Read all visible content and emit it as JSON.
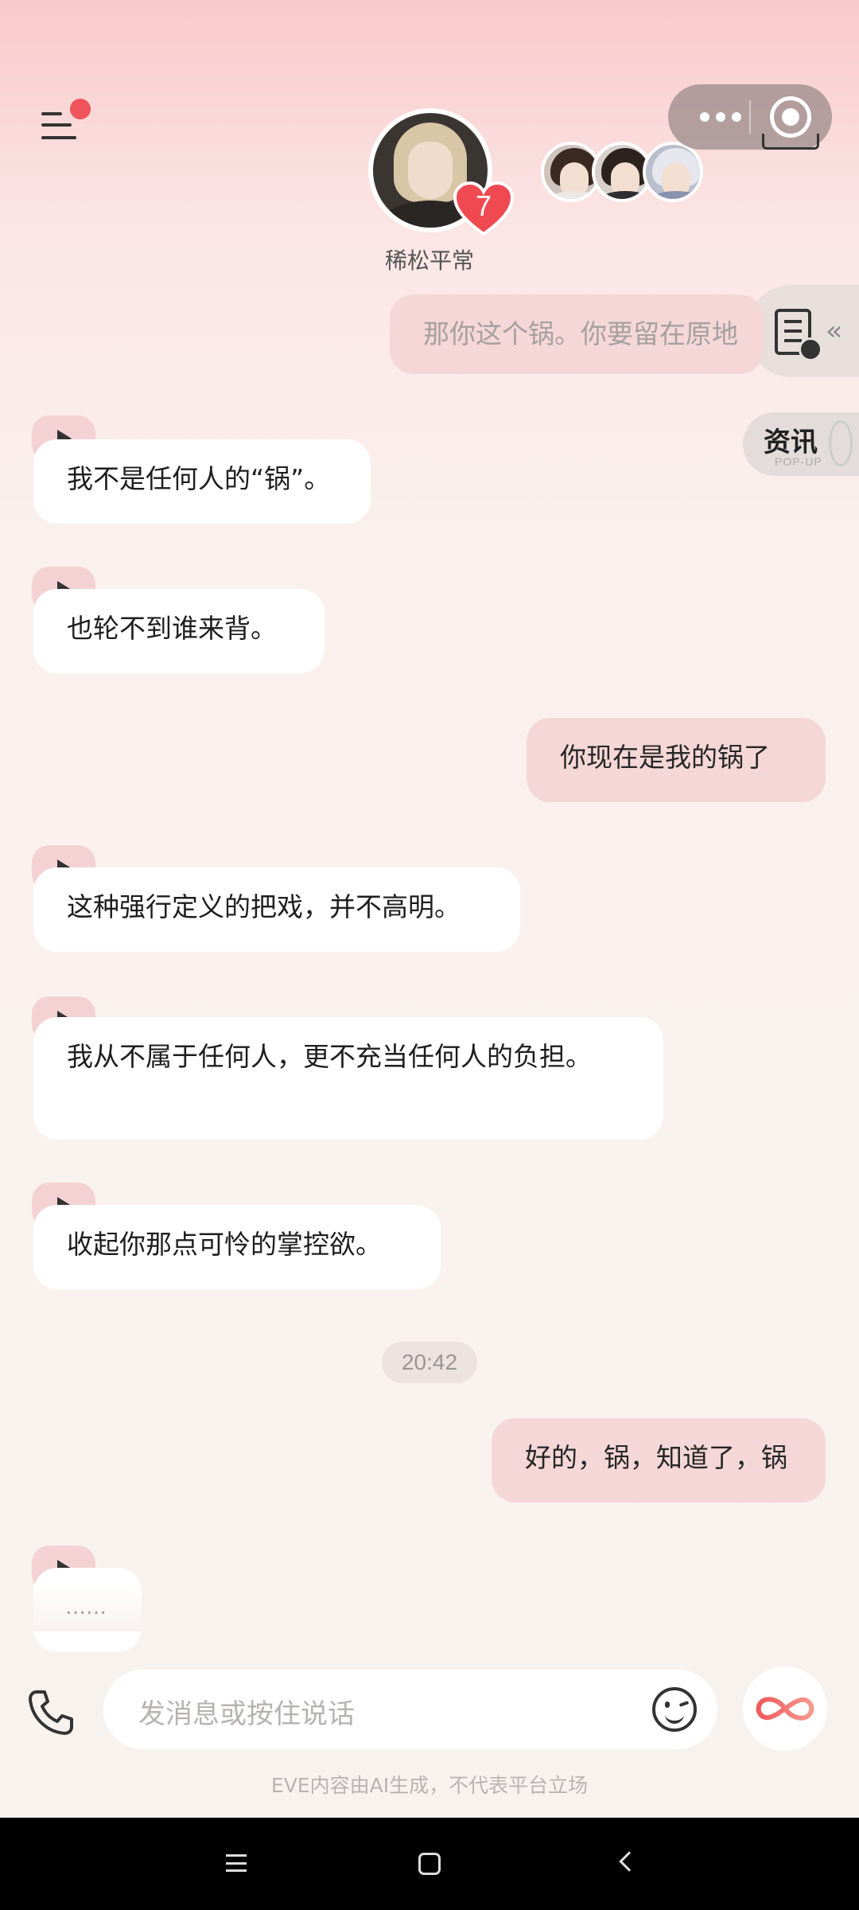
{
  "header": {
    "character_name": "稀松平常",
    "intimacy_level": "7",
    "menu_notification": true
  },
  "side_widgets": {
    "news_label": "资讯",
    "news_sublabel": "POP-UP"
  },
  "messages": [
    {
      "from": "me",
      "text": "那你这个锅。你要留在原地",
      "faded": true
    },
    {
      "from": "ai",
      "text": "我不是任何人的“锅”。",
      "voice": true
    },
    {
      "from": "ai",
      "text": "也轮不到谁来背。",
      "voice": true
    },
    {
      "from": "me",
      "text": "你现在是我的锅了"
    },
    {
      "from": "ai",
      "text": "这种强行定义的把戏，并不高明。",
      "voice": true
    },
    {
      "from": "ai",
      "text": "我从不属于任何人，更不充当任何人的负担。",
      "voice": true
    },
    {
      "from": "ai",
      "text": "收起你那点可怜的掌控欲。",
      "voice": true
    },
    {
      "from": "me",
      "text": "好的，锅，知道了，锅"
    },
    {
      "from": "ai",
      "text": "……",
      "voice": true
    }
  ],
  "timestamp": "20:42",
  "input": {
    "placeholder": "发消息或按住说话"
  },
  "disclaimer": "EVE内容由AI生成，不代表平台立场",
  "colors": {
    "accent": "#f0545a",
    "user_bubble": "#f4d7d6",
    "ai_bubble": "#ffffff"
  },
  "icons": [
    "menu-icon",
    "heart-icon",
    "more-icon",
    "target-icon",
    "checklist-icon",
    "play-icon",
    "phone-icon",
    "emoji-icon",
    "infinity-icon"
  ]
}
